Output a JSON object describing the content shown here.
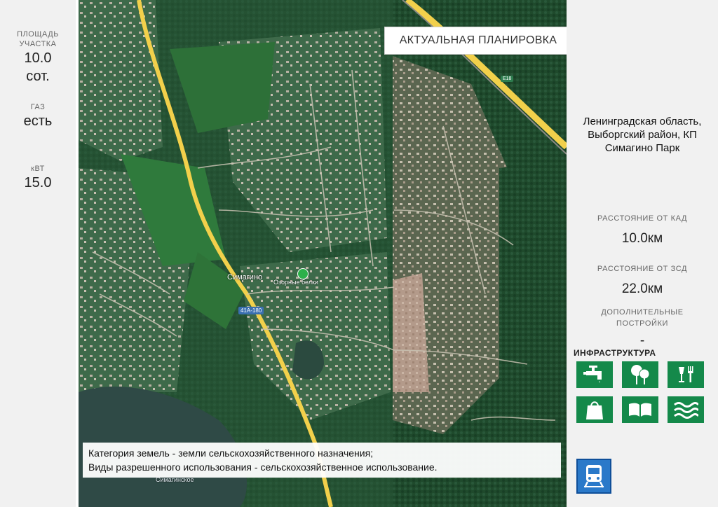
{
  "left": {
    "area_label_1": "ПЛОЩАДЬ",
    "area_label_2": "УЧАСТКА",
    "area_value": "10.0",
    "area_unit": "сот.",
    "gas_label": "ГАЗ",
    "gas_value": "есть",
    "power_label": "кВТ",
    "power_value": "15.0"
  },
  "map": {
    "plan_badge": "АКТУАЛЬНАЯ ПЛАНИРОВКА",
    "place_simagino": "Симагино",
    "place_belki": "Озорные белки",
    "road_badge": "41А-180",
    "road_badge_e18": "E18",
    "lake_label": "Симагинское",
    "colors": {
      "road": "#f2d04b",
      "forest": "#1f4a2c",
      "field": "#2f7a3c",
      "lake": "#2f4a46"
    }
  },
  "land_info": {
    "line1": "Категория земель - земли сельскохозяйственного назначения;",
    "line2": "Виды разрешенного использования - сельскохозяйственное использование."
  },
  "right": {
    "address_1": "Ленинградская область,",
    "address_2": "Выборгский район, КП",
    "address_3": "Симагино Парк",
    "kad_label": "РАССТОЯНИЕ ОТ КАД",
    "kad_value": "10.0км",
    "zsd_label": "РАССТОЯНИЕ ОТ ЗСД",
    "zsd_value": "22.0км",
    "extra_label_1": "ДОПОЛНИТЕЛЬНЫЕ",
    "extra_label_2": "ПОСТРОЙКИ",
    "extra_value": "-",
    "infra_title": "ИНФРАСТРУКТУРА",
    "infra_icons": [
      "water-icon",
      "forest-icon",
      "restaurant-icon",
      "shop-icon",
      "library-icon",
      "water-body-icon"
    ],
    "transport_icon": "train-icon",
    "colors": {
      "infra_green": "#14894a",
      "train_blue": "#2a79c9"
    }
  }
}
